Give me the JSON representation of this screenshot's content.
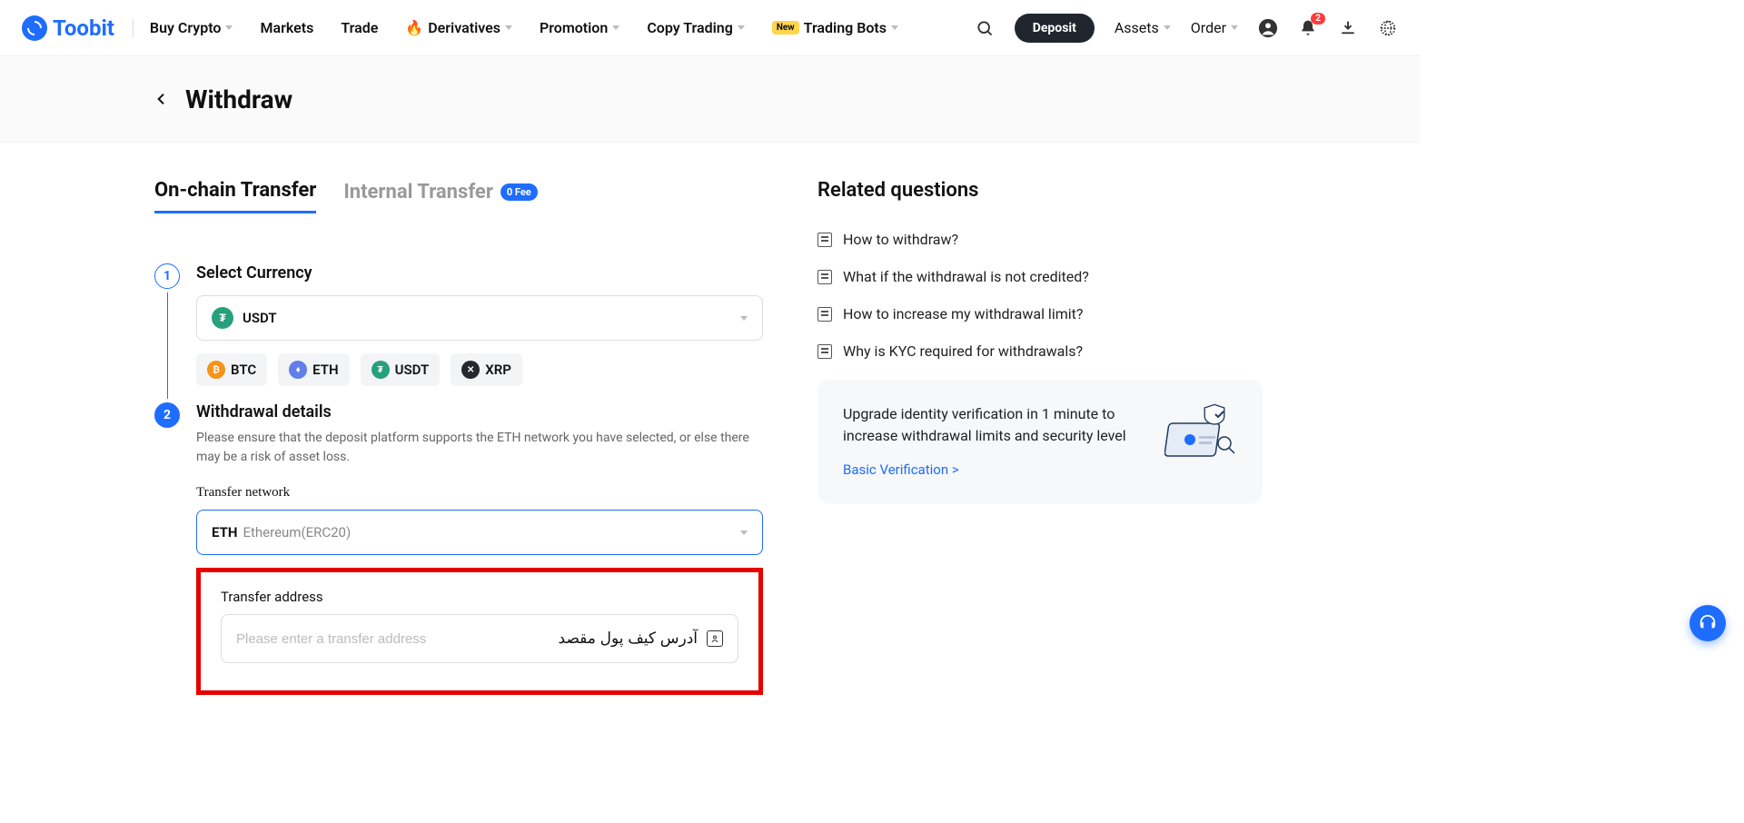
{
  "brand": "Toobit",
  "nav": {
    "buy": "Buy Crypto",
    "markets": "Markets",
    "trade": "Trade",
    "derivatives": "Derivatives",
    "promotion": "Promotion",
    "copy": "Copy Trading",
    "bots_badge": "New",
    "bots": "Trading Bots"
  },
  "topRight": {
    "deposit": "Deposit",
    "assets": "Assets",
    "order": "Order",
    "notif_count": "2"
  },
  "page": {
    "title": "Withdraw"
  },
  "tabs": {
    "onchain": "On-chain Transfer",
    "internal": "Internal Transfer",
    "fee_badge": "0 Fee"
  },
  "step1": {
    "title": "Select Currency",
    "selected": "USDT",
    "shortcuts": [
      "BTC",
      "ETH",
      "USDT",
      "XRP"
    ]
  },
  "step2": {
    "title": "Withdrawal details",
    "desc": "Please ensure that the deposit platform supports the ETH network you have selected, or else there may be a risk of asset loss.",
    "net_label": "Transfer network",
    "net_code": "ETH",
    "net_name": "Ethereum(ERC20)",
    "addr_label": "Transfer address",
    "addr_placeholder": "Please enter a transfer address",
    "addr_overlay": "آدرس کیف پول مقصد"
  },
  "related": {
    "title": "Related questions",
    "items": [
      "How to withdraw?",
      "What if the withdrawal is not credited?",
      "How to increase my withdrawal limit?",
      "Why is KYC required for withdrawals?"
    ]
  },
  "upgrade": {
    "text": "Upgrade identity verification in 1 minute to increase withdrawal limits and security level",
    "link": "Basic Verification >"
  }
}
